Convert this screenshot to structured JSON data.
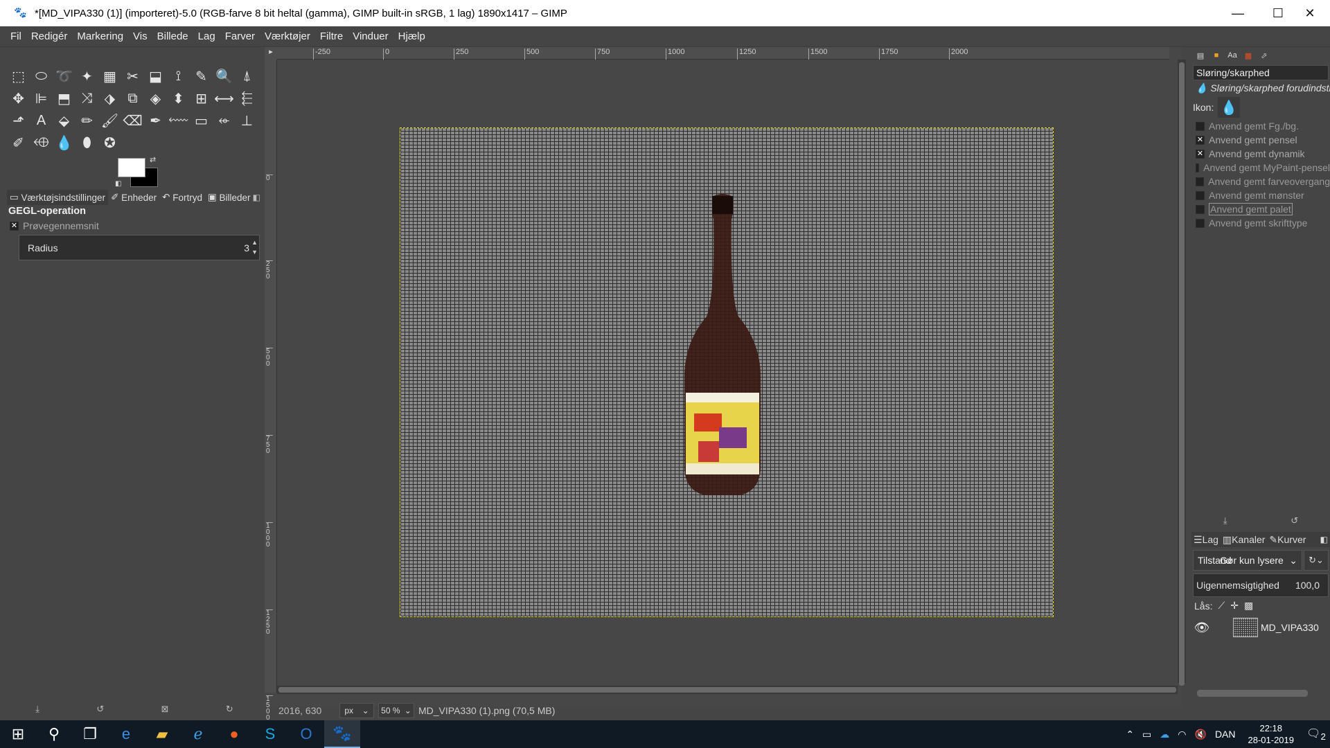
{
  "window": {
    "title": "*[MD_VIPA330 (1)] (importeret)-5.0 (RGB-farve 8 bit heltal (gamma), GIMP built-in sRGB, 1 lag) 1890x1417 – GIMP",
    "minimize": "—",
    "maximize": "☐",
    "close": "✕"
  },
  "menu": [
    "Fil",
    "Redigér",
    "Markering",
    "Vis",
    "Billede",
    "Lag",
    "Farver",
    "Værktøjer",
    "Filtre",
    "Vinduer",
    "Hjælp"
  ],
  "tools": [
    "⬚",
    "⬭",
    "➰",
    "✦",
    "▦",
    "✂",
    "⬓",
    "⟟",
    "✎",
    "🔍",
    "⍋",
    "✥",
    "⊫",
    "⬒",
    "⤨",
    "⬗",
    "⧉",
    "◈",
    "⬍",
    "⊞",
    "⟷",
    "⬱",
    "⬏",
    "A",
    "⬙",
    "✏",
    "🖌",
    "⌫",
    "✒",
    "⬳",
    "▭",
    "⬰",
    "⊥",
    "✐",
    "⬲",
    "💧",
    "⬮",
    "✪"
  ],
  "dock_tabs": [
    "Værktøjsindstillinger",
    "Enheder",
    "Fortryd",
    "Billeder"
  ],
  "tool_options": {
    "title": "GEGL-operation",
    "sampling": "Prøvegennemsnit",
    "radius_label": "Radius",
    "radius_value": "3"
  },
  "ruler_top": [
    "-250",
    "0",
    "250",
    "500",
    "750",
    "1000",
    "1250",
    "1500",
    "1750",
    "2000"
  ],
  "ruler_left": [
    "0",
    "250",
    "500",
    "750",
    "1000",
    "1250",
    "1500"
  ],
  "status": {
    "coords": "2016, 630",
    "unit": "px",
    "zoom": "50 %",
    "file": "MD_VIPA330 (1).png (70,5 MB)"
  },
  "presets": {
    "name": "Sløring/skarphed",
    "description": "Sløring/skarphed forudindstilling",
    "icon_label": "Ikon:",
    "options": [
      {
        "label": "Anvend gemt Fg./bg.",
        "checked": false
      },
      {
        "label": "Anvend gemt pensel",
        "checked": true
      },
      {
        "label": "Anvend gemt dynamik",
        "checked": true
      },
      {
        "label": "Anvend gemt MyPaint-pensel",
        "checked": false
      },
      {
        "label": "Anvend gemt farveovergang",
        "checked": false
      },
      {
        "label": "Anvend gemt mønster",
        "checked": false
      },
      {
        "label": "Anvend gemt palet",
        "checked": false
      },
      {
        "label": "Anvend gemt skrifttype",
        "checked": false
      }
    ]
  },
  "layers": {
    "tabs": [
      "Lag",
      "Kanaler",
      "Kurver"
    ],
    "mode": "Tilstand",
    "mode_value": "Gør kun lysere",
    "opacity_label": "Uigennemsigtighed",
    "opacity_value": "100,0",
    "lock_label": "Lås:",
    "layer_name": "MD_VIPA330"
  },
  "taskbar": {
    "language": "DAN",
    "time": "22:18",
    "date": "28-01-2019",
    "notifications": "2"
  }
}
